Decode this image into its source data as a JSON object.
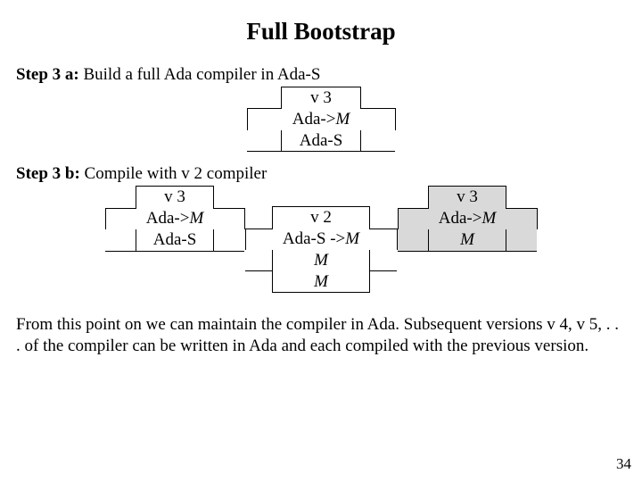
{
  "title": "Full Bootstrap",
  "step3a": {
    "label": "Step 3 a:",
    "text": " Build a full Ada compiler in Ada-S",
    "t": {
      "top": "v 3",
      "mid": "Ada->M",
      "bot": "Ada-S"
    }
  },
  "step3b": {
    "label": "Step 3 b:",
    "text": " Compile with v 2 compiler",
    "left": {
      "top": "v 3",
      "mid": "Ada->M",
      "bot": "Ada-S"
    },
    "center": {
      "top": "v 2",
      "mid": "Ada-S ->M",
      "bot1": "M",
      "bot2": "M"
    },
    "right": {
      "top": "v 3",
      "mid": "Ada->M",
      "bot": "M"
    }
  },
  "footer": "From this point on we can maintain the compiler in Ada. Subsequent versions v 4, v 5, . . . of the compiler can be written in Ada and each compiled with the previous version.",
  "pagenum": "34"
}
